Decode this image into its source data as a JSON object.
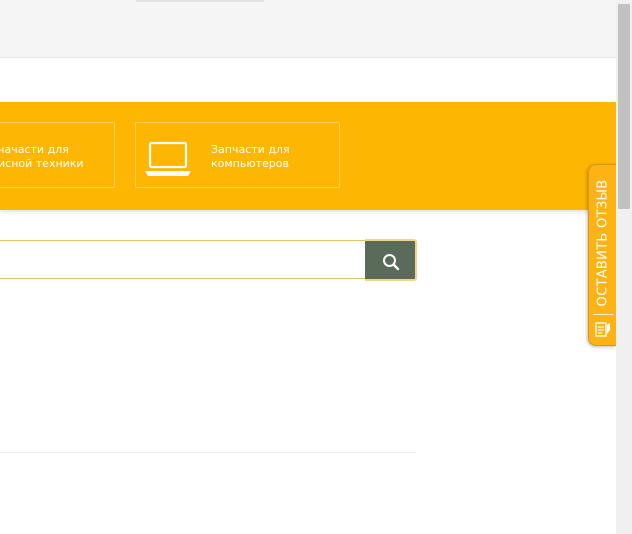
{
  "categories": [
    {
      "label": "Запчасти для\nофисной техники",
      "visible_label": "чачасти для\nисной техники"
    },
    {
      "label": "Запчасти для\nкомпьютеров"
    }
  ],
  "search": {
    "placeholder": "",
    "value": ""
  },
  "feedback": {
    "label": "ОСТАВИТЬ ОТЗЫВ"
  },
  "colors": {
    "accent": "#fdb702",
    "search_button": "#5b6b5a",
    "feedback_tab": "#fbb414"
  },
  "icons": {
    "laptop": "laptop-icon",
    "search": "search-icon",
    "feedback": "feedback-note-icon"
  }
}
